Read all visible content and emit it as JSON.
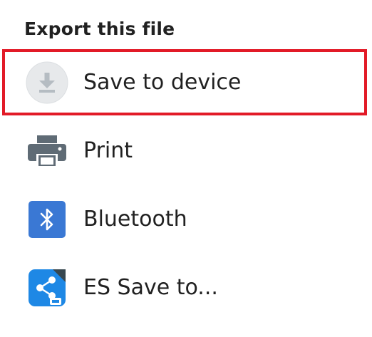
{
  "dialog": {
    "title": "Export this file",
    "items": [
      {
        "label": "Save to device",
        "icon": "download-icon",
        "highlighted": true
      },
      {
        "label": "Print",
        "icon": "printer-icon"
      },
      {
        "label": "Bluetooth",
        "icon": "bluetooth-icon"
      },
      {
        "label": "ES Save to...",
        "icon": "es-share-icon"
      }
    ]
  },
  "colors": {
    "highlight": "#e21a27",
    "text": "#212121",
    "printer": "#5f6b75",
    "bluetooth": "#3a78d4",
    "es_blue": "#1e88e5"
  }
}
